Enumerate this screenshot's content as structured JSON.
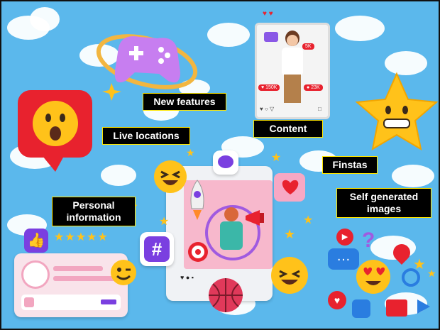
{
  "labels": {
    "new_features": "New features",
    "live_locations": "Live locations",
    "content": "Content",
    "finstas": "Finstas",
    "personal_information": "Personal information",
    "self_generated_images": "Self generated images"
  },
  "post_stats": {
    "likes": "150K",
    "comments": "23K",
    "followers": "5K"
  },
  "colors": {
    "sky": "#5bb8ec",
    "label_bg": "#000000",
    "label_text": "#ffffff",
    "label_border": "#ffe600",
    "accent_pink": "#f7a8c4",
    "accent_red": "#e8222e",
    "accent_purple": "#7a3fe0",
    "star_yellow": "#ffc21a"
  },
  "icons": [
    "game-controller-icon",
    "speech-bubble-shocked-icon",
    "star-face-icon",
    "laughing-emoji-icon",
    "heart-bubble-icon",
    "chat-bubble-icon",
    "rocket-icon",
    "megaphone-icon",
    "hashtag-icon",
    "target-icon",
    "basketball-icon",
    "thumbs-up-icon",
    "heart-eyes-emoji-icon",
    "location-pin-icon",
    "magnifier-icon"
  ]
}
